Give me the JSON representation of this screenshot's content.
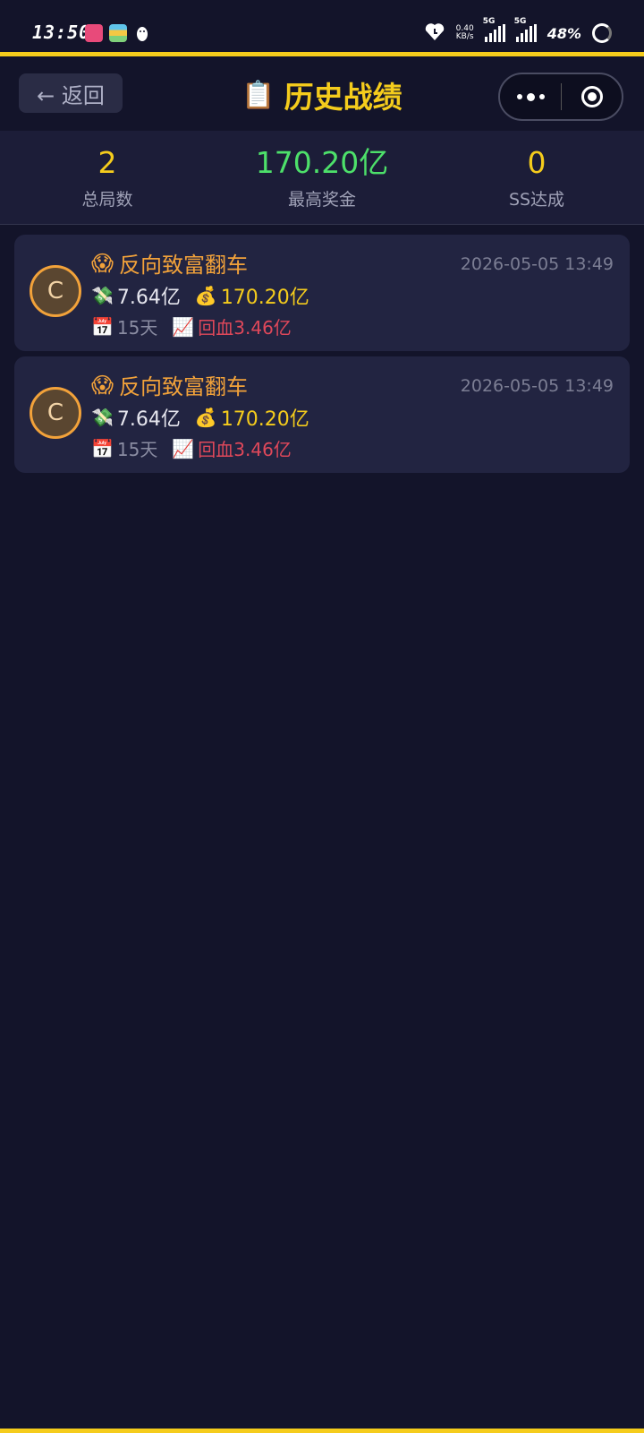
{
  "status_bar": {
    "time": "13:50",
    "net_speed": "0.40",
    "net_unit": "KB/s",
    "signal_1": "5G",
    "signal_2": "5G",
    "battery": "48%"
  },
  "header": {
    "back_label": "← 返回",
    "title_icon": "📋",
    "title": "历史战绩"
  },
  "stats": [
    {
      "value": "2",
      "label": "总局数",
      "color": "#f5cc1c"
    },
    {
      "value": "170.20亿",
      "label": "最高奖金",
      "color": "#4de06a"
    },
    {
      "value": "0",
      "label": "SS达成",
      "color": "#f5cc1c"
    }
  ],
  "records": [
    {
      "grade": "C",
      "emoji": "😱",
      "title": "反向致富翻车",
      "time": "2026-05-05 13:49",
      "cost_icon": "💸",
      "cost": "7.64亿",
      "prize_icon": "💰",
      "prize": "170.20亿",
      "days_icon": "📅",
      "days": "15天",
      "recover_icon": "📈",
      "recover": "回血3.46亿"
    },
    {
      "grade": "C",
      "emoji": "😱",
      "title": "反向致富翻车",
      "time": "2026-05-05 13:49",
      "cost_icon": "💸",
      "cost": "7.64亿",
      "prize_icon": "💰",
      "prize": "170.20亿",
      "days_icon": "📅",
      "days": "15天",
      "recover_icon": "📈",
      "recover": "回血3.46亿"
    }
  ],
  "colors": {
    "accent": "#f5cc1c",
    "prize_green": "#4de06a",
    "title_orange": "#f2a23a",
    "recover_red": "#e0485a",
    "background": "#13142a"
  }
}
